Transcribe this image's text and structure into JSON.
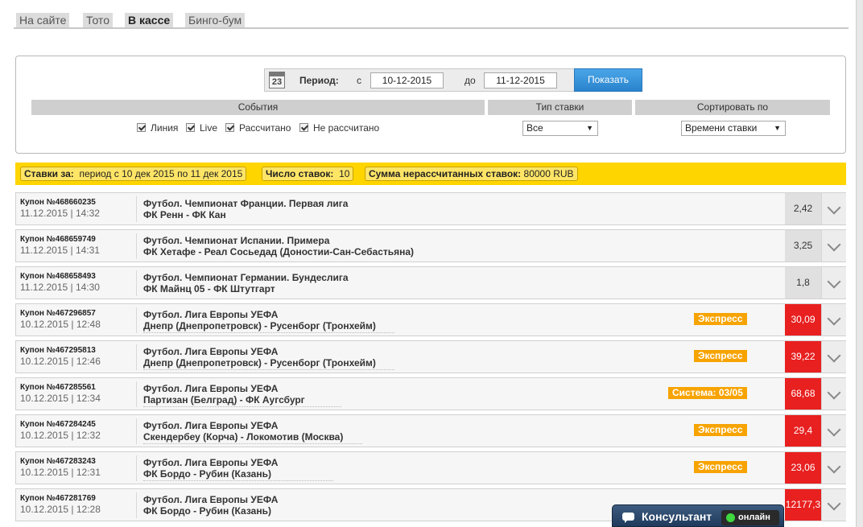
{
  "tabs": [
    "На сайте",
    "Тото",
    "В кассе",
    "Бинго-бум"
  ],
  "filter": {
    "period_label": "Период:",
    "from_label": "с",
    "from_date": "10-12-2015",
    "to_label": "до",
    "to_date": "11-12-2015",
    "show_button": "Показать",
    "calendar_day": "23",
    "headers": {
      "events": "События",
      "bet_type": "Тип ставки",
      "sort_by": "Сортировать по"
    },
    "checkboxes": [
      "Линия",
      "Live",
      "Рассчитано",
      "Не рассчитано"
    ],
    "bet_type_value": "Все",
    "sort_value": "Времени ставки"
  },
  "summary": {
    "bets_for_label": "Ставки за:",
    "bets_for_value": "период с 10 дек 2015 по 11 дек 2015",
    "count_label": "Число ставок:",
    "count_value": "10",
    "sum_label": "Сумма нерассчитанных ставок:",
    "sum_value": "80000 RUB"
  },
  "coupons": [
    {
      "coupon": "Купон №468660235",
      "date": "11.12.2015 | 14:32",
      "event": "Футбол. Чемпионат Франции. Первая лига",
      "teams": "ФК Ренн - ФК Кан",
      "badge": "",
      "odds": "2,42",
      "status": "grey"
    },
    {
      "coupon": "Купон №468659749",
      "date": "11.12.2015 | 14:31",
      "event": "Футбол. Чемпионат Испании. Примера",
      "teams": "ФК Хетафе - Реал Сосьедад (Доностии-Сан-Себастьяна)",
      "badge": "",
      "odds": "3,25",
      "status": "grey"
    },
    {
      "coupon": "Купон №468658493",
      "date": "11.12.2015 | 14:30",
      "event": "Футбол. Чемпионат Германии. Бундеслига",
      "teams": "ФК Майнц 05 - ФК Штутгарт",
      "badge": "",
      "odds": "1,8",
      "status": "grey"
    },
    {
      "coupon": "Купон №467296857",
      "date": "10.12.2015 | 12:48",
      "event": "Футбол. Лига Европы УЕФА",
      "teams": "Днепр (Днепропетровск) - Русенборг (Тронхейм)",
      "badge": "Экспресс",
      "odds": "30,09",
      "status": "red"
    },
    {
      "coupon": "Купон №467295813",
      "date": "10.12.2015 | 12:46",
      "event": "Футбол. Лига Европы УЕФА",
      "teams": "Днепр (Днепропетровск) - Русенборг (Тронхейм)",
      "badge": "Экспресс",
      "odds": "39,22",
      "status": "red"
    },
    {
      "coupon": "Купон №467285561",
      "date": "10.12.2015 | 12:34",
      "event": "Футбол. Лига Европы УЕФА",
      "teams": "Партизан (Белград) - ФК Аугсбург",
      "badge": "Система: 03/05",
      "odds": "68,68",
      "status": "red"
    },
    {
      "coupon": "Купон №467284245",
      "date": "10.12.2015 | 12:32",
      "event": "Футбол. Лига Европы УЕФА",
      "teams": "Скендербеу (Корча) - Локомотив (Москва)",
      "badge": "Экспресс",
      "odds": "29,4",
      "status": "red"
    },
    {
      "coupon": "Купон №467283243",
      "date": "10.12.2015 | 12:31",
      "event": "Футбол. Лига Европы УЕФА",
      "teams": "ФК Бордо - Рубин (Казань)",
      "badge": "Экспресс",
      "odds": "23,06",
      "status": "red"
    },
    {
      "coupon": "Купон №467281769",
      "date": "10.12.2015 | 12:28",
      "event": "Футбол. Лига Европы УЕФА",
      "teams": "ФК Бордо - Рубин (Казань)",
      "badge": "",
      "odds": "12177,3",
      "status": "red"
    }
  ],
  "consultant": {
    "label": "Консультант",
    "status": "онлайн"
  }
}
